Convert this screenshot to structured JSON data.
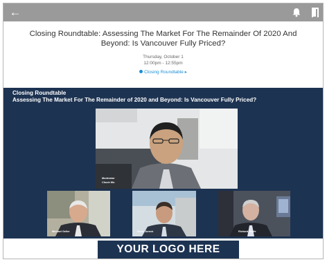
{
  "header": {
    "title": "Closing Roundtable: Assessing The Market For The Remainder Of 2020 And Beyond: Is Vancouver Fully Priced?",
    "date": "Thursday, October 1",
    "time": "12:00pm - 12:55pm",
    "track": "Closing Roundtable"
  },
  "stage": {
    "heading_line1": "Closing Roundtable",
    "heading_line2": "Assessing The Market For The Remainder of 2020 and Beyond: Is Vancouver Fully Priced?",
    "main_role": "Moderator",
    "main_name": "Chuck Wu",
    "panelists": [
      "Michael Geller",
      "Ozzie Jurock",
      "Richard Wolfe"
    ]
  },
  "footer": {
    "logo_text": "YOUR LOGO HERE"
  },
  "colors": {
    "topbar": "#9a9a9a",
    "stage": "#1d3352",
    "link": "#1d8fd6"
  },
  "icons": {
    "back": "arrow-left-icon",
    "bell": "bell-icon",
    "exit": "exit-door-icon"
  }
}
